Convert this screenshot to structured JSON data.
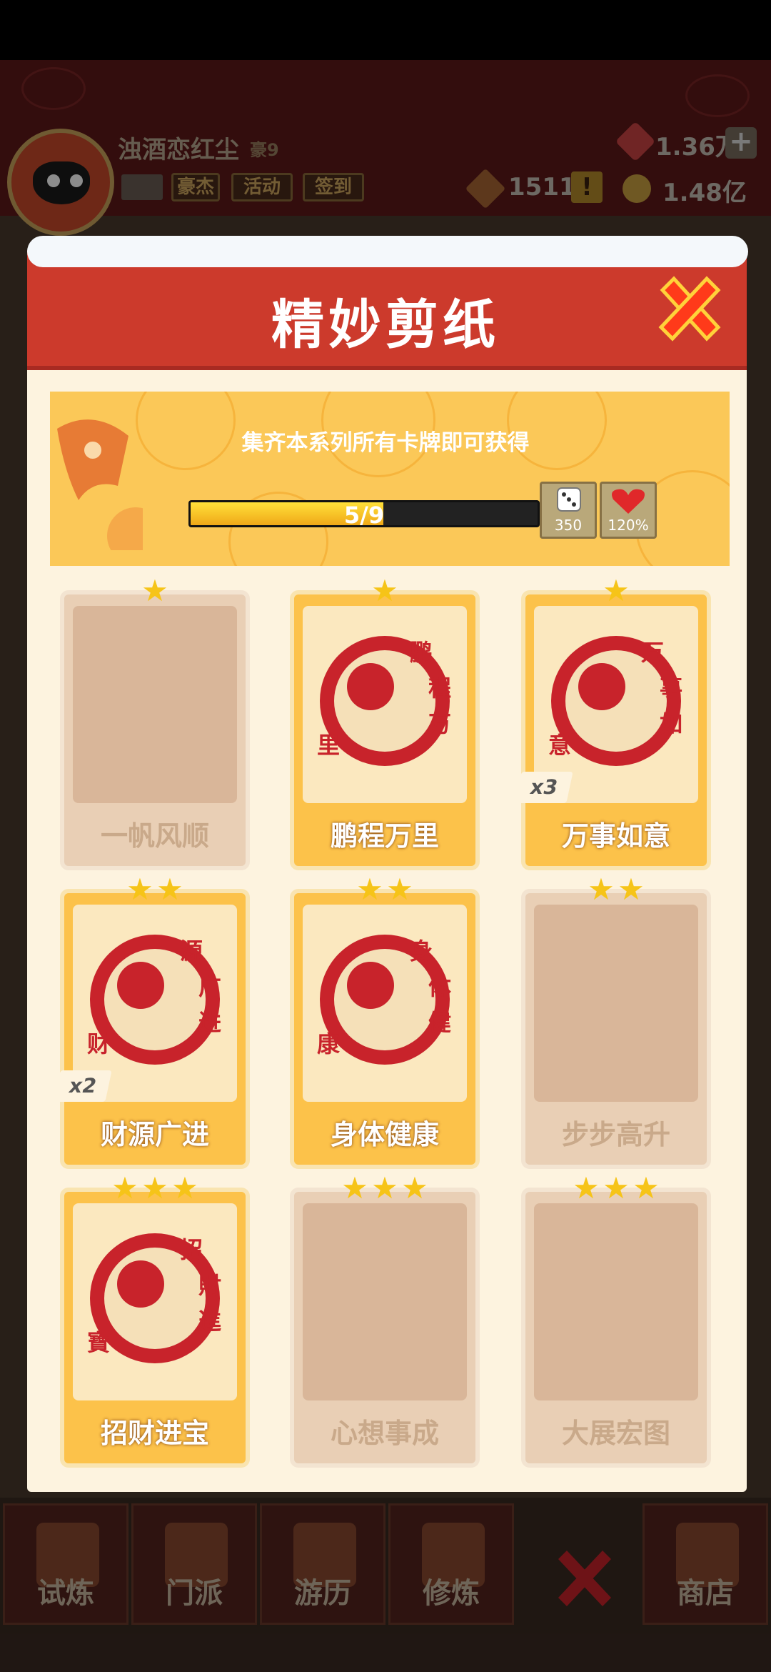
{
  "player": {
    "name": "浊酒恋红尘",
    "rank": "豪9"
  },
  "top_buttons": {
    "hero": "豪杰",
    "event": "活动",
    "checkin": "签到"
  },
  "resources": {
    "gem": "1.36万",
    "token": "1511",
    "gold": "1.48亿"
  },
  "panel": {
    "title": "精妙剪纸",
    "banner_text": "集齐本系列所有卡牌即可获得",
    "progress_text": "5/9",
    "progress_fraction": 0.556,
    "rewards": [
      {
        "icon": "dice-icon",
        "value": "350"
      },
      {
        "icon": "heart-icon",
        "value": "120%"
      }
    ]
  },
  "cards": [
    {
      "name": "一帆风顺",
      "stars": 1,
      "owned": false,
      "count": ""
    },
    {
      "name": "鹏程万里",
      "stars": 1,
      "owned": true,
      "count": ""
    },
    {
      "name": "万事如意",
      "stars": 1,
      "owned": true,
      "count": "x3"
    },
    {
      "name": "财源广进",
      "stars": 2,
      "owned": true,
      "count": "x2"
    },
    {
      "name": "身体健康",
      "stars": 2,
      "owned": true,
      "count": ""
    },
    {
      "name": "步步高升",
      "stars": 2,
      "owned": false,
      "count": ""
    },
    {
      "name": "招财进宝",
      "stars": 3,
      "owned": true,
      "count": ""
    },
    {
      "name": "心想事成",
      "stars": 3,
      "owned": false,
      "count": ""
    },
    {
      "name": "大展宏图",
      "stars": 3,
      "owned": false,
      "count": ""
    }
  ],
  "card_art_text": {
    "c1": [
      "鹏",
      "程",
      "万",
      "里"
    ],
    "c2": [
      "万",
      "事",
      "如",
      "意"
    ],
    "c3": [
      "源",
      "广",
      "进",
      "财"
    ],
    "c4": [
      "身",
      "体",
      "健",
      "康"
    ],
    "c6": [
      "招",
      "財",
      "進",
      "寶"
    ]
  },
  "bottom_nav": [
    {
      "label": "试炼"
    },
    {
      "label": "门派"
    },
    {
      "label": "游历"
    },
    {
      "label": "修炼"
    },
    {
      "label": "商店"
    }
  ],
  "colors": {
    "accent_red": "#cc3a2c",
    "gold": "#fcc24a",
    "star": "#f6c418"
  }
}
